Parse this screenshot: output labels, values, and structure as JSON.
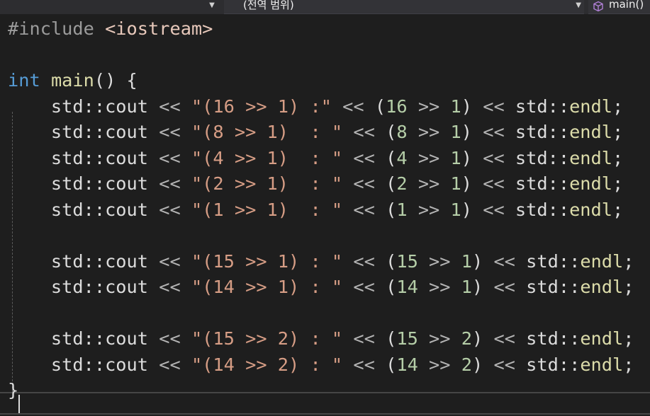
{
  "navbar": {
    "scope_label": "(전역 범위)",
    "function_label": "main()",
    "left_dropdown_icon": "chevron-down-icon",
    "scope_dropdown_icon": "chevron-down-icon",
    "function_icon": "cube-icon"
  },
  "editor": {
    "lines": [
      [
        [
          "t-pp",
          "#include "
        ],
        [
          "t-inc",
          "<iostream>"
        ]
      ],
      [],
      [
        [
          "t-kw",
          "int"
        ],
        [
          "t-id",
          " "
        ],
        [
          "t-fn",
          "main"
        ],
        [
          "t-id",
          "() {"
        ]
      ],
      [
        [
          "t-id",
          "    std::cout "
        ],
        [
          "t-op",
          "<<"
        ],
        [
          "t-id",
          " "
        ],
        [
          "t-str",
          "\"(16 >> 1) :\""
        ],
        [
          "t-id",
          " "
        ],
        [
          "t-op",
          "<<"
        ],
        [
          "t-id",
          " ("
        ],
        [
          "t-num",
          "16"
        ],
        [
          "t-id",
          " "
        ],
        [
          "t-op",
          ">>"
        ],
        [
          "t-id",
          " "
        ],
        [
          "t-num",
          "1"
        ],
        [
          "t-id",
          ") "
        ],
        [
          "t-op",
          "<<"
        ],
        [
          "t-id",
          " std::"
        ],
        [
          "t-fn",
          "endl"
        ],
        [
          "t-id",
          ";"
        ]
      ],
      [
        [
          "t-id",
          "    std::cout "
        ],
        [
          "t-op",
          "<<"
        ],
        [
          "t-id",
          " "
        ],
        [
          "t-str",
          "\"(8 >> 1)  : \""
        ],
        [
          "t-id",
          " "
        ],
        [
          "t-op",
          "<<"
        ],
        [
          "t-id",
          " ("
        ],
        [
          "t-num",
          "8"
        ],
        [
          "t-id",
          " "
        ],
        [
          "t-op",
          ">>"
        ],
        [
          "t-id",
          " "
        ],
        [
          "t-num",
          "1"
        ],
        [
          "t-id",
          ") "
        ],
        [
          "t-op",
          "<<"
        ],
        [
          "t-id",
          " std::"
        ],
        [
          "t-fn",
          "endl"
        ],
        [
          "t-id",
          ";"
        ]
      ],
      [
        [
          "t-id",
          "    std::cout "
        ],
        [
          "t-op",
          "<<"
        ],
        [
          "t-id",
          " "
        ],
        [
          "t-str",
          "\"(4 >> 1)  : \""
        ],
        [
          "t-id",
          " "
        ],
        [
          "t-op",
          "<<"
        ],
        [
          "t-id",
          " ("
        ],
        [
          "t-num",
          "4"
        ],
        [
          "t-id",
          " "
        ],
        [
          "t-op",
          ">>"
        ],
        [
          "t-id",
          " "
        ],
        [
          "t-num",
          "1"
        ],
        [
          "t-id",
          ") "
        ],
        [
          "t-op",
          "<<"
        ],
        [
          "t-id",
          " std::"
        ],
        [
          "t-fn",
          "endl"
        ],
        [
          "t-id",
          ";"
        ]
      ],
      [
        [
          "t-id",
          "    std::cout "
        ],
        [
          "t-op",
          "<<"
        ],
        [
          "t-id",
          " "
        ],
        [
          "t-str",
          "\"(2 >> 1)  : \""
        ],
        [
          "t-id",
          " "
        ],
        [
          "t-op",
          "<<"
        ],
        [
          "t-id",
          " ("
        ],
        [
          "t-num",
          "2"
        ],
        [
          "t-id",
          " "
        ],
        [
          "t-op",
          ">>"
        ],
        [
          "t-id",
          " "
        ],
        [
          "t-num",
          "1"
        ],
        [
          "t-id",
          ") "
        ],
        [
          "t-op",
          "<<"
        ],
        [
          "t-id",
          " std::"
        ],
        [
          "t-fn",
          "endl"
        ],
        [
          "t-id",
          ";"
        ]
      ],
      [
        [
          "t-id",
          "    std::cout "
        ],
        [
          "t-op",
          "<<"
        ],
        [
          "t-id",
          " "
        ],
        [
          "t-str",
          "\"(1 >> 1)  : \""
        ],
        [
          "t-id",
          " "
        ],
        [
          "t-op",
          "<<"
        ],
        [
          "t-id",
          " ("
        ],
        [
          "t-num",
          "1"
        ],
        [
          "t-id",
          " "
        ],
        [
          "t-op",
          ">>"
        ],
        [
          "t-id",
          " "
        ],
        [
          "t-num",
          "1"
        ],
        [
          "t-id",
          ") "
        ],
        [
          "t-op",
          "<<"
        ],
        [
          "t-id",
          " std::"
        ],
        [
          "t-fn",
          "endl"
        ],
        [
          "t-id",
          ";"
        ]
      ],
      [],
      [
        [
          "t-id",
          "    std::cout "
        ],
        [
          "t-op",
          "<<"
        ],
        [
          "t-id",
          " "
        ],
        [
          "t-str",
          "\"(15 >> 1) : \""
        ],
        [
          "t-id",
          " "
        ],
        [
          "t-op",
          "<<"
        ],
        [
          "t-id",
          " ("
        ],
        [
          "t-num",
          "15"
        ],
        [
          "t-id",
          " "
        ],
        [
          "t-op",
          ">>"
        ],
        [
          "t-id",
          " "
        ],
        [
          "t-num",
          "1"
        ],
        [
          "t-id",
          ") "
        ],
        [
          "t-op",
          "<<"
        ],
        [
          "t-id",
          " std::"
        ],
        [
          "t-fn",
          "endl"
        ],
        [
          "t-id",
          ";"
        ]
      ],
      [
        [
          "t-id",
          "    std::cout "
        ],
        [
          "t-op",
          "<<"
        ],
        [
          "t-id",
          " "
        ],
        [
          "t-str",
          "\"(14 >> 1) : \""
        ],
        [
          "t-id",
          " "
        ],
        [
          "t-op",
          "<<"
        ],
        [
          "t-id",
          " ("
        ],
        [
          "t-num",
          "14"
        ],
        [
          "t-id",
          " "
        ],
        [
          "t-op",
          ">>"
        ],
        [
          "t-id",
          " "
        ],
        [
          "t-num",
          "1"
        ],
        [
          "t-id",
          ") "
        ],
        [
          "t-op",
          "<<"
        ],
        [
          "t-id",
          " std::"
        ],
        [
          "t-fn",
          "endl"
        ],
        [
          "t-id",
          ";"
        ]
      ],
      [],
      [
        [
          "t-id",
          "    std::cout "
        ],
        [
          "t-op",
          "<<"
        ],
        [
          "t-id",
          " "
        ],
        [
          "t-str",
          "\"(15 >> 2) : \""
        ],
        [
          "t-id",
          " "
        ],
        [
          "t-op",
          "<<"
        ],
        [
          "t-id",
          " ("
        ],
        [
          "t-num",
          "15"
        ],
        [
          "t-id",
          " "
        ],
        [
          "t-op",
          ">>"
        ],
        [
          "t-id",
          " "
        ],
        [
          "t-num",
          "2"
        ],
        [
          "t-id",
          ") "
        ],
        [
          "t-op",
          "<<"
        ],
        [
          "t-id",
          " std::"
        ],
        [
          "t-fn",
          "endl"
        ],
        [
          "t-id",
          ";"
        ]
      ],
      [
        [
          "t-id",
          "    std::cout "
        ],
        [
          "t-op",
          "<<"
        ],
        [
          "t-id",
          " "
        ],
        [
          "t-str",
          "\"(14 >> 2) : \""
        ],
        [
          "t-id",
          " "
        ],
        [
          "t-op",
          "<<"
        ],
        [
          "t-id",
          " ("
        ],
        [
          "t-num",
          "14"
        ],
        [
          "t-id",
          " "
        ],
        [
          "t-op",
          ">>"
        ],
        [
          "t-id",
          " "
        ],
        [
          "t-num",
          "2"
        ],
        [
          "t-id",
          ") "
        ],
        [
          "t-op",
          "<<"
        ],
        [
          "t-id",
          " std::"
        ],
        [
          "t-fn",
          "endl"
        ],
        [
          "t-id",
          ";"
        ]
      ],
      [
        [
          "t-id",
          "}"
        ]
      ]
    ]
  }
}
